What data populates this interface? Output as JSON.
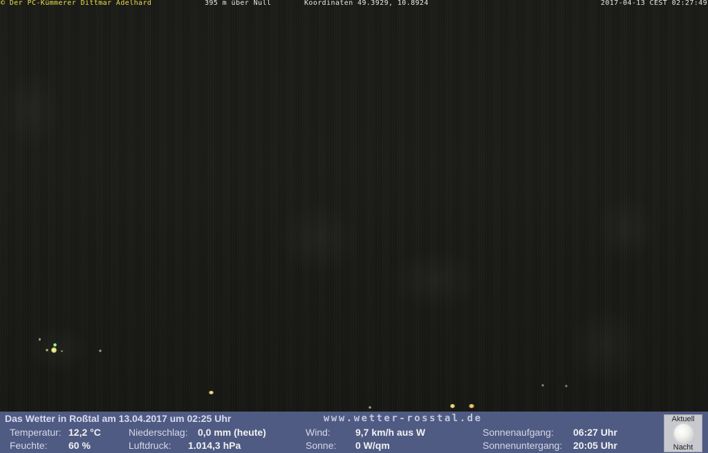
{
  "overlay": {
    "copyright": "© Der PC-Kümmerer Dittmar Adelhard",
    "altitude": "395 m über Null",
    "coordinates": "Koordinaten 49.3929, 10.8924",
    "timestamp": "2017-04-13 CEST 02:27:49"
  },
  "weather": {
    "title": "Das Wetter in Roßtal am 13.04.2017 um 02:25 Uhr",
    "url": "www.wetter-rosstal.de",
    "temperature_label": "Temperatur:",
    "temperature_value": "12,2 °C",
    "humidity_label": "Feuchte:",
    "humidity_value": "60 %",
    "precip_label": "Niederschlag:",
    "precip_value": "0,0 mm (heute)",
    "pressure_label": "Luftdruck:",
    "pressure_value": "1.014,3 hPa",
    "wind_label": "Wind:",
    "wind_value": "9,7 km/h aus W",
    "sun_label": "Sonne:",
    "sun_value": "0 W/qm",
    "sunrise_label": "Sonnenaufgang:",
    "sunrise_value": "06:27 Uhr",
    "sunset_label": "Sonnenuntergang:",
    "sunset_value": "20:05 Uhr"
  },
  "moon": {
    "top_label": "Aktuell",
    "bottom_label": "Nacht",
    "icon": "moon-icon"
  },
  "colors": {
    "overlay_highlight": "#e8e14a",
    "panel_background": "#4f5b83"
  }
}
